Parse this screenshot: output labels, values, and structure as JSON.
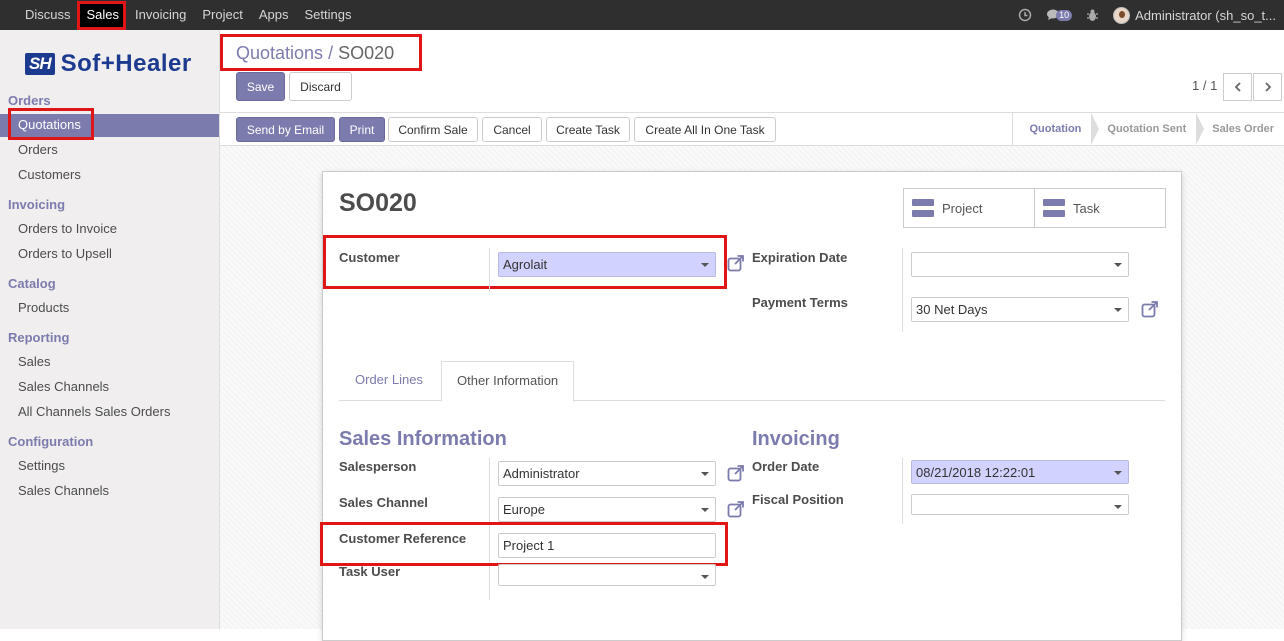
{
  "topnav": {
    "items": [
      "Discuss",
      "Sales",
      "Invoicing",
      "Project",
      "Apps",
      "Settings"
    ],
    "message_count": "10",
    "user": "Administrator (sh_so_t..."
  },
  "brand": {
    "mark": "SH",
    "name": "Sof+Healer"
  },
  "sidebar": {
    "sections": [
      {
        "title": "Orders",
        "items": [
          "Quotations",
          "Orders",
          "Customers"
        ]
      },
      {
        "title": "Invoicing",
        "items": [
          "Orders to Invoice",
          "Orders to Upsell"
        ]
      },
      {
        "title": "Catalog",
        "items": [
          "Products"
        ]
      },
      {
        "title": "Reporting",
        "items": [
          "Sales",
          "Sales Channels",
          "All Channels Sales Orders"
        ]
      },
      {
        "title": "Configuration",
        "items": [
          "Settings",
          "Sales Channels"
        ]
      }
    ]
  },
  "breadcrumb": {
    "parent": "Quotations",
    "sep": "/",
    "current": "SO020"
  },
  "toolbar": {
    "save": "Save",
    "discard": "Discard",
    "pager": "1 / 1"
  },
  "header_buttons": [
    "Send by Email",
    "Print",
    "Confirm Sale",
    "Cancel",
    "Create Task",
    "Create All In One Task"
  ],
  "stages": [
    "Quotation",
    "Quotation Sent",
    "Sales Order"
  ],
  "form": {
    "name": "SO020",
    "smart_buttons": [
      "Project",
      "Task"
    ],
    "customer_label": "Customer",
    "customer_value": "Agrolait",
    "expiration_label": "Expiration Date",
    "expiration_value": "",
    "payment_terms_label": "Payment Terms",
    "payment_terms_value": "30 Net Days",
    "tabs": [
      "Order Lines",
      "Other Information"
    ],
    "sales_info_title": "Sales Information",
    "salesperson_label": "Salesperson",
    "salesperson_value": "Administrator",
    "sales_channel_label": "Sales Channel",
    "sales_channel_value": "Europe",
    "customer_ref_label": "Customer Reference",
    "customer_ref_value": "Project 1",
    "task_user_label": "Task User",
    "task_user_value": "",
    "invoicing_title": "Invoicing",
    "order_date_label": "Order Date",
    "order_date_value": "08/21/2018 12:22:01",
    "fiscal_position_label": "Fiscal Position",
    "fiscal_position_value": ""
  },
  "colors": {
    "accent": "#7c7bad",
    "highlight": "#e01616",
    "topbar": "#2f2f2f"
  }
}
